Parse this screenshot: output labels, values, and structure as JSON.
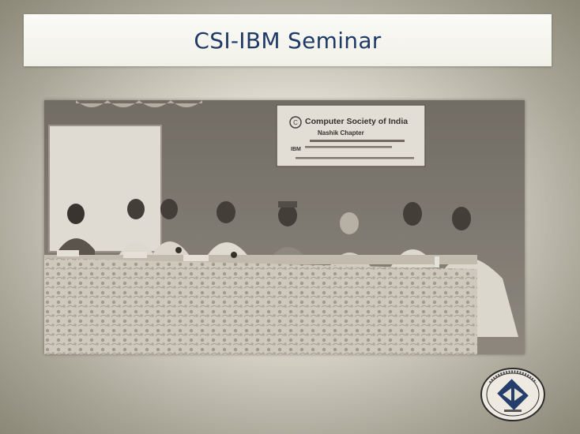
{
  "slide": {
    "title": "CSI-IBM Seminar"
  },
  "photo": {
    "banner": {
      "line1": "Computer Society of India",
      "line2": "Nashik Chapter",
      "line3": "",
      "ibm": "IBM"
    }
  },
  "logo": {
    "icon": "csi-emblem-icon"
  },
  "colors": {
    "title_text": "#1f3a66",
    "title_bar": "#f3f2ea",
    "background_center": "#f4f2ec",
    "background_edge": "#8b8878",
    "photo_tone": "#8a8478"
  }
}
